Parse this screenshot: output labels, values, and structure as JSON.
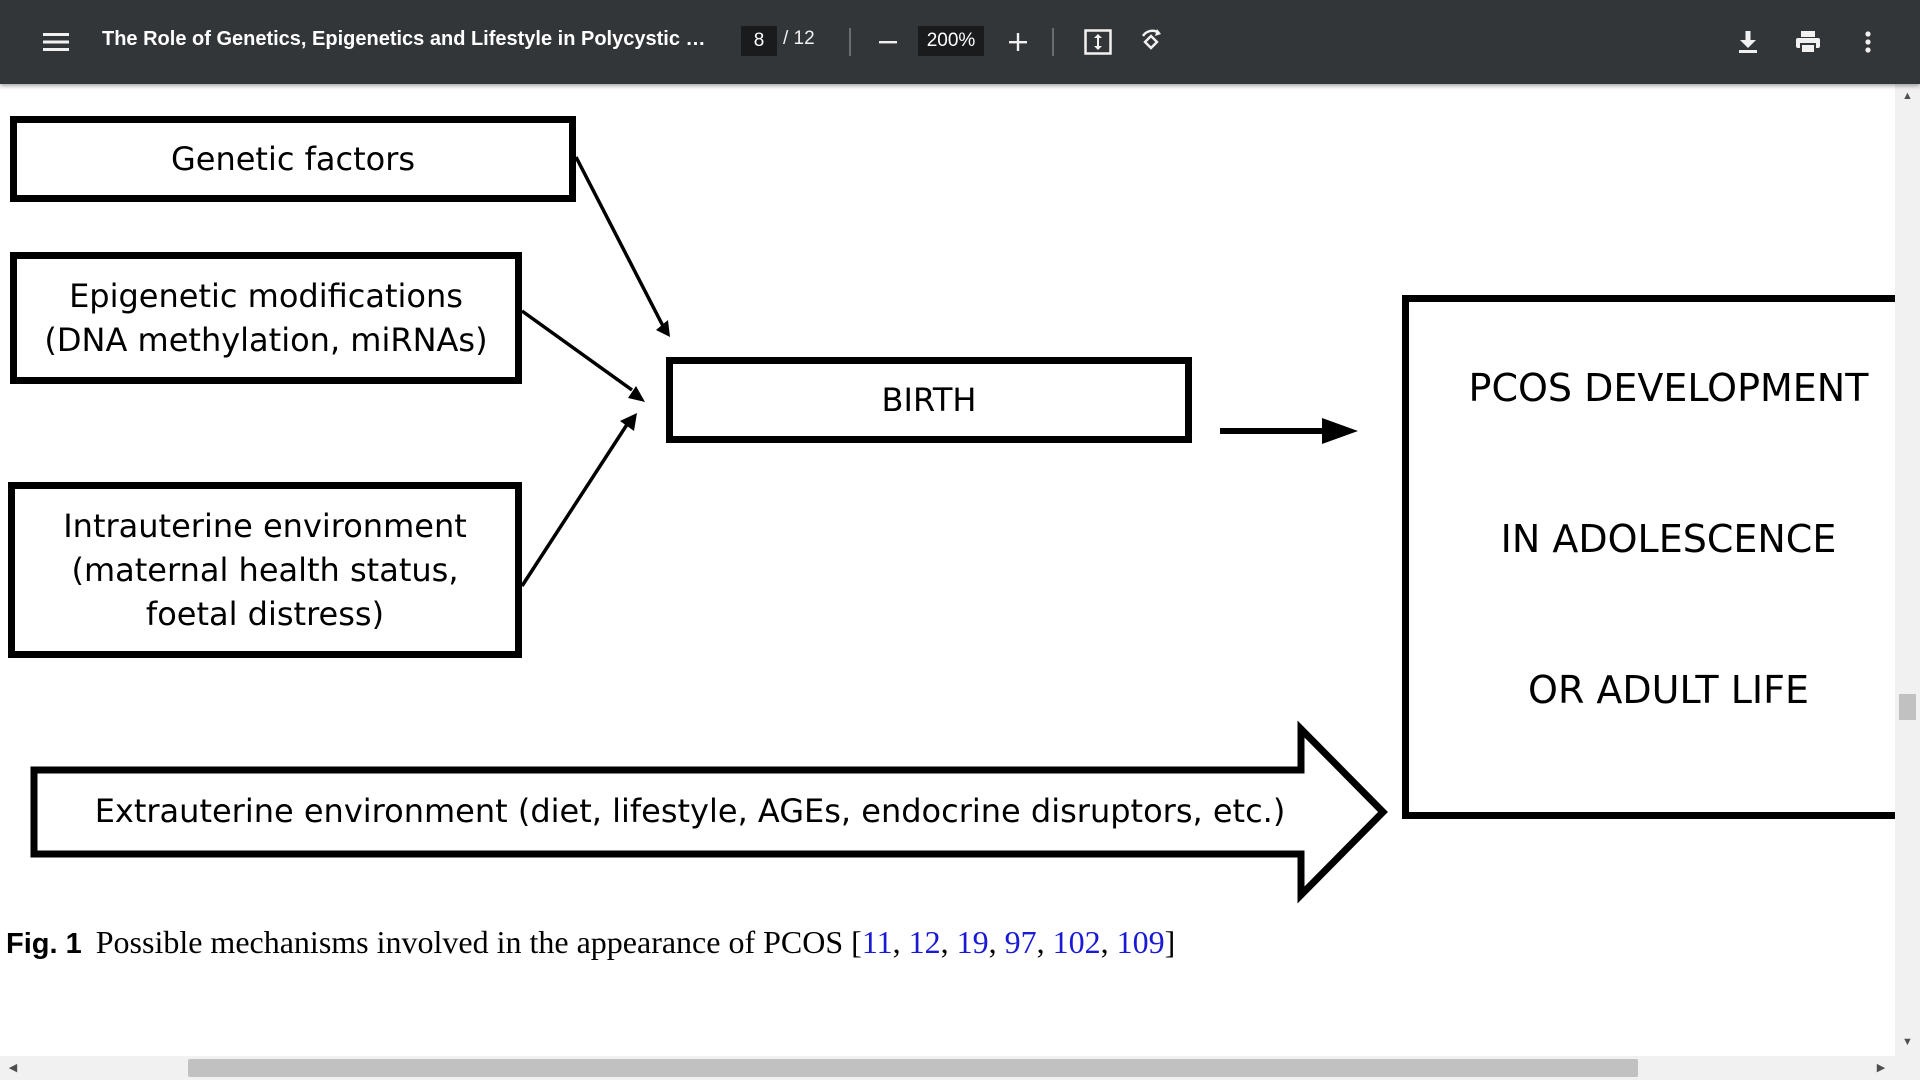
{
  "toolbar": {
    "title": "The Role of Genetics, Epigenetics and Lifestyle in Polycystic Ov...",
    "page_current": "8",
    "page_total": "/ 12",
    "zoom": "200%",
    "icons": [
      "menu-icon",
      "zoom-out-icon",
      "zoom-in-icon",
      "fit-page-icon",
      "rotate-icon",
      "download-icon",
      "print-icon",
      "more-vert-icon"
    ]
  },
  "diagram": {
    "genetic": "Genetic factors",
    "epigenetic": [
      "Epigenetic modifications",
      "(DNA methylation, miRNAs)"
    ],
    "intrauterine": [
      "Intrauterine environment",
      "(maternal health status,",
      "foetal distress)"
    ],
    "birth": "BIRTH",
    "pcos": [
      "PCOS DEVELOPMENT",
      "IN ADOLESCENCE",
      "OR ADULT LIFE"
    ],
    "extrauterine": "Extrauterine environment (diet, lifestyle, AGEs, endocrine disruptors, etc.)"
  },
  "caption": {
    "label": "Fig. 1",
    "text": "Possible mechanisms involved in the appearance of PCOS [",
    "refs": [
      "11",
      "12",
      "19",
      "97",
      "102",
      "109"
    ],
    "close": "]"
  },
  "colors": {
    "toolbar_bg": "#323639",
    "link": "#1a1ad6",
    "scroll_track": "#f1f1f1",
    "scroll_thumb": "#c1c1c1"
  }
}
